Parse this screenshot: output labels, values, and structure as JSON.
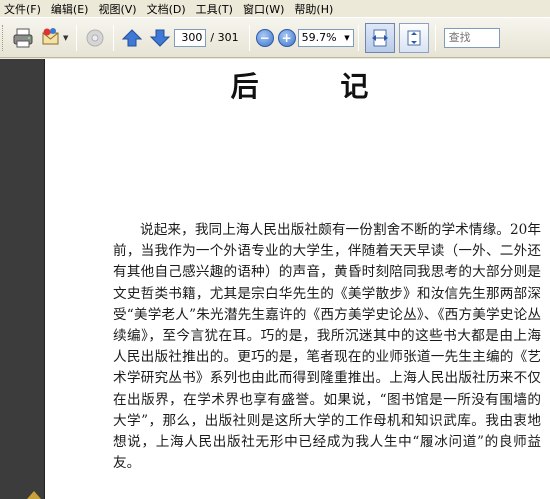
{
  "menu": {
    "items": [
      "文件(F)",
      "编辑(E)",
      "视图(V)",
      "文档(D)",
      "工具(T)",
      "窗口(W)",
      "帮助(H)"
    ]
  },
  "toolbar": {
    "current_page": "300",
    "total_pages": "/ 301",
    "zoom": "59.7%",
    "search_placeholder": "查找"
  },
  "icons": {
    "print": "printer-icon",
    "email": "email-icon",
    "disabled": "disc-icon",
    "prev": "arrow-up-icon",
    "next": "arrow-down-icon",
    "zoom_out": "zoom-out-icon",
    "zoom_in": "zoom-in-icon",
    "fit_width": "fit-width-icon",
    "fit_page": "fit-page-icon"
  },
  "document": {
    "title": "后 记",
    "paragraph": "说起来，我同上海人民出版社颇有一份割舍不断的学术情缘。20年前，当我作为一个外语专业的大学生，伴随着天天早读（一外、二外还有其他自己感兴趣的语种）的声音，黄昏时刻陪同我思考的大部分则是文史哲类书籍，尤其是宗白华先生的《美学散步》和汝信先生那两部深受“美学老人”朱光潜先生嘉许的《西方美学史论丛》、《西方美学史论丛续编》，至今言犹在耳。巧的是，我所沉迷其中的这些书大都是由上海人民出版社推出的。更巧的是，笔者现在的业师张道一先生主编的《艺术学研究丛书》系列也由此而得到隆重推出。上海人民出版社历来不仅在出版界，在学术界也享有盛誉。如果说，“图书馆是一所没有围墙的大学”，那么，出版社则是这所大学的工作母机和知识武库。我由衷地想说，上海人民出版社无形中已经成为我人生中“履冰问道”的良师益友。"
  },
  "colors": {
    "chrome": "#ece9d8",
    "page": "#ffffff",
    "left_pane": "#3c3c3c",
    "accent_blue": "#3f74c9"
  }
}
